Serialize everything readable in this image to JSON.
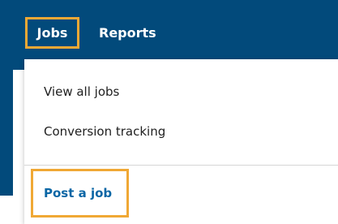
{
  "navbar": {
    "items": [
      {
        "label": "Jobs"
      },
      {
        "label": "Reports"
      }
    ]
  },
  "dropdown": {
    "items": [
      {
        "label": "View all jobs"
      },
      {
        "label": "Conversion tracking"
      }
    ],
    "primary_action": "Post a job"
  },
  "colors": {
    "nav_bg": "#024a7b",
    "highlight": "#f0a835",
    "link": "#0a66a5"
  }
}
